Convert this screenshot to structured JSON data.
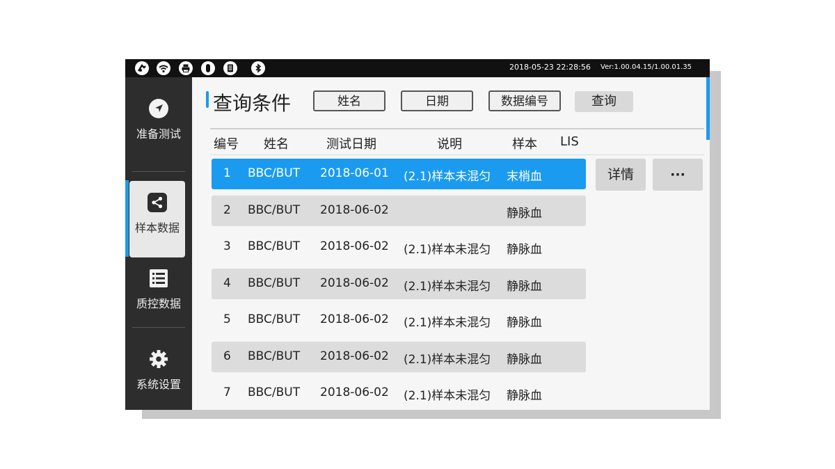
{
  "status_bar": {
    "icons": [
      "gauge-icon",
      "wifi-icon",
      "printer-icon",
      "mouse-icon",
      "storage-icon",
      "bluetooth-icon"
    ],
    "datetime": "2018-05-23 22:28:56",
    "version": "Ver:1.00.04.15/1.00.01.35"
  },
  "sidebar": {
    "items": [
      {
        "label": "准备测试",
        "icon": "navigation-icon",
        "active": false
      },
      {
        "label": "样本数据",
        "icon": "share-icon",
        "active": true
      },
      {
        "label": "质控数据",
        "icon": "list-icon",
        "active": false
      },
      {
        "label": "系统设置",
        "icon": "gear-icon",
        "active": false
      }
    ]
  },
  "query": {
    "title": "查询条件",
    "filters": [
      "姓名",
      "日期",
      "数据编号"
    ],
    "search_label": "查询"
  },
  "table": {
    "headers": [
      "编号",
      "姓名",
      "测试日期",
      "说明",
      "样本",
      "LIS"
    ],
    "rows": [
      {
        "no": "1",
        "name": "BBC/BUT",
        "date": "2018-06-01",
        "note": "(2.1)样本未混匀",
        "sample": "末梢血",
        "lis": "",
        "selected": true
      },
      {
        "no": "2",
        "name": "BBC/BUT",
        "date": "2018-06-02",
        "note": "",
        "sample": "静脉血",
        "lis": "",
        "selected": false
      },
      {
        "no": "3",
        "name": "BBC/BUT",
        "date": "2018-06-02",
        "note": "(2.1)样本未混匀",
        "sample": "静脉血",
        "lis": "",
        "selected": false
      },
      {
        "no": "4",
        "name": "BBC/BUT",
        "date": "2018-06-02",
        "note": "(2.1)样本未混匀",
        "sample": "静脉血",
        "lis": "",
        "selected": false
      },
      {
        "no": "5",
        "name": "BBC/BUT",
        "date": "2018-06-02",
        "note": "(2.1)样本未混匀",
        "sample": "静脉血",
        "lis": "",
        "selected": false
      },
      {
        "no": "6",
        "name": "BBC/BUT",
        "date": "2018-06-02",
        "note": "(2.1)样本未混匀",
        "sample": "静脉血",
        "lis": "",
        "selected": false
      },
      {
        "no": "7",
        "name": "BBC/BUT",
        "date": "2018-06-02",
        "note": "(2.1)样本未混匀",
        "sample": "静脉血",
        "lis": "",
        "selected": false
      }
    ]
  },
  "actions": {
    "detail_label": "详情",
    "more_label": "···"
  },
  "colors": {
    "accent": "#1a9bf0",
    "sidebar_bg": "#2d2d2d",
    "statusbar_bg": "#111111"
  }
}
